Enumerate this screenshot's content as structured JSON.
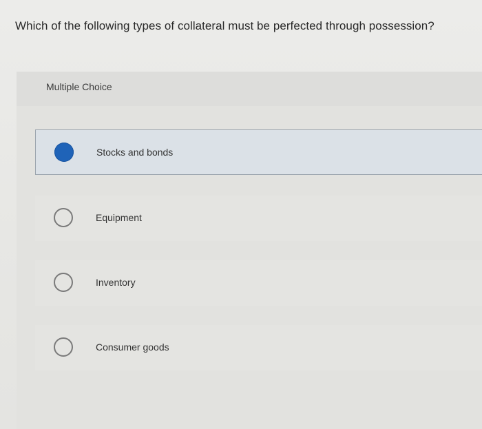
{
  "question": {
    "text": "Which of the following types of collateral must be perfected through possession?"
  },
  "card": {
    "type_label": "Multiple Choice"
  },
  "choices": [
    {
      "label": "Stocks and bonds",
      "selected": true
    },
    {
      "label": "Equipment",
      "selected": false
    },
    {
      "label": "Inventory",
      "selected": false
    },
    {
      "label": "Consumer goods",
      "selected": false
    }
  ],
  "colors": {
    "selected_radio": "#1f63b8",
    "selected_background": "#dbe1e7",
    "page_background": "#e9e9e7"
  }
}
